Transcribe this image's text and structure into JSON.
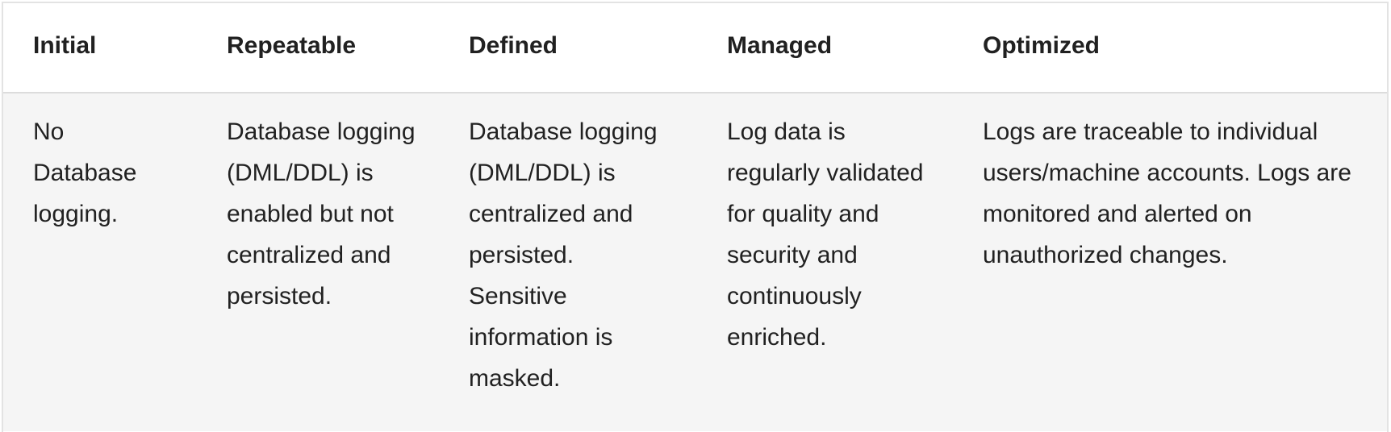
{
  "table": {
    "headers": [
      "Initial",
      "Repeatable",
      "Defined",
      "Managed",
      "Optimized"
    ],
    "rows": [
      [
        "No Database logging.",
        "Database logging (DML/DDL) is enabled but not centralized and persisted.",
        "Database logging (DML/DDL) is centralized and persisted. Sensitive information is masked.",
        "Log data is regularly validated for quality and security and continuously enriched.",
        "Logs are traceable to individual users/machine accounts. Logs are monitored and alerted on unauthorized changes."
      ]
    ]
  }
}
